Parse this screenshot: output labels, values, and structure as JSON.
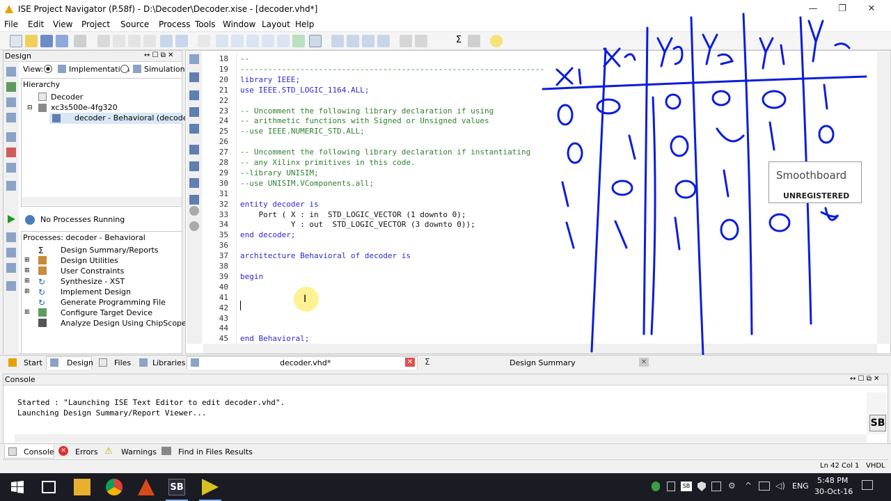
{
  "window": {
    "title": "ISE Project Navigator (P.58f) - D:\\Decoder\\Decoder.xise - [decoder.vhd*]",
    "minimize": "—",
    "restore": "❐",
    "close": "✕"
  },
  "menu": [
    "File",
    "Edit",
    "View",
    "Project",
    "Source",
    "Process",
    "Tools",
    "Window",
    "Layout",
    "Help"
  ],
  "design_panel": {
    "title": "Design",
    "view_label": "View:",
    "view_impl": "Implementation",
    "view_sim": "Simulation",
    "hierarchy_title": "Hierarchy",
    "tree": [
      "Decoder",
      "xc3s500e-4fg320",
      "decoder - Behavioral (decoder.v"
    ],
    "no_processes": "No Processes Running",
    "processes_title": "Processes: decoder - Behavioral",
    "processes": [
      "Design Summary/Reports",
      "Design Utilities",
      "User Constraints",
      "Synthesize - XST",
      "Implement Design",
      "Generate Programming File",
      "Configure Target Device",
      "Analyze Design Using ChipScope"
    ]
  },
  "left_tabs": [
    "Start",
    "Design",
    "Files",
    "Libraries"
  ],
  "editor": {
    "lines": [
      {
        "n": "18",
        "t": "--",
        "c": "cm"
      },
      {
        "n": "19",
        "t": "------------------------------------------------------------------",
        "c": "cm"
      },
      {
        "n": "20",
        "t": "library IEEE;",
        "c": "kw"
      },
      {
        "n": "21",
        "t": "use IEEE.STD_LOGIC_1164.ALL;",
        "c": "kw"
      },
      {
        "n": "22",
        "t": "",
        "c": ""
      },
      {
        "n": "23",
        "t": "-- Uncomment the following library declaration if using",
        "c": "cm"
      },
      {
        "n": "24",
        "t": "-- arithmetic functions with Signed or Unsigned values",
        "c": "cm"
      },
      {
        "n": "25",
        "t": "--use IEEE.NUMERIC_STD.ALL;",
        "c": "cm"
      },
      {
        "n": "26",
        "t": "",
        "c": ""
      },
      {
        "n": "27",
        "t": "-- Uncomment the following library declaration if instantiating",
        "c": "cm"
      },
      {
        "n": "28",
        "t": "-- any Xilinx primitives in this code.",
        "c": "cm"
      },
      {
        "n": "29",
        "t": "--library UNISIM;",
        "c": "cm"
      },
      {
        "n": "30",
        "t": "--use UNISIM.VComponents.all;",
        "c": "cm"
      },
      {
        "n": "31",
        "t": "",
        "c": ""
      },
      {
        "n": "32",
        "t": "entity decoder is",
        "c": "kw"
      },
      {
        "n": "33",
        "t": "    Port ( X : in  STD_LOGIC_VECTOR (1 downto 0);",
        "c": ""
      },
      {
        "n": "34",
        "t": "           Y : out  STD_LOGIC_VECTOR (3 downto 0));",
        "c": ""
      },
      {
        "n": "35",
        "t": "end decoder;",
        "c": "kw"
      },
      {
        "n": "36",
        "t": "",
        "c": ""
      },
      {
        "n": "37",
        "t": "architecture Behavioral of decoder is",
        "c": "kw"
      },
      {
        "n": "38",
        "t": "",
        "c": ""
      },
      {
        "n": "39",
        "t": "begin",
        "c": "kw"
      },
      {
        "n": "40",
        "t": "",
        "c": ""
      },
      {
        "n": "41",
        "t": "",
        "c": ""
      },
      {
        "n": "42",
        "t": "",
        "c": ""
      },
      {
        "n": "43",
        "t": "",
        "c": ""
      },
      {
        "n": "44",
        "t": "",
        "c": ""
      },
      {
        "n": "45",
        "t": "end Behavioral;",
        "c": "kw"
      }
    ]
  },
  "editor_tabs": [
    "decoder.vhd*",
    "Design Summary"
  ],
  "console": {
    "title": "Console",
    "lines": [
      "Started : \"Launching ISE Text Editor to edit decoder.vhd\".",
      "Launching Design Summary/Report Viewer..."
    ]
  },
  "console_tabs": [
    "Console",
    "Errors",
    "Warnings",
    "Find in Files Results"
  ],
  "status": {
    "pos": "Ln 42 Col 1",
    "lang": "VHDL"
  },
  "smoothboard": {
    "name": "Smoothboard",
    "badge": "UNREGISTERED"
  },
  "taskbar": {
    "time": "5:48 PM",
    "date": "30-Oct-16",
    "lang": "ENG",
    "sb_label": "SB"
  },
  "handwriting": {
    "headers": [
      "X1",
      "X0",
      "Y3",
      "Y2",
      "Y1",
      "Y0"
    ]
  },
  "colors": {
    "accent": "#0f56d8",
    "ink": "#0a1ddb",
    "taskbar": "#1b1b24"
  }
}
